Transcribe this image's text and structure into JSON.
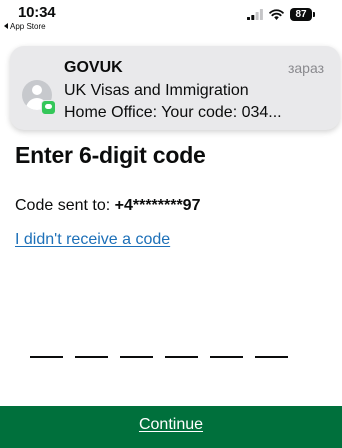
{
  "status_bar": {
    "time": "10:34",
    "back_label": "App Store",
    "battery_level": "87",
    "icons": [
      "signal-icon",
      "wifi-icon",
      "battery-icon"
    ]
  },
  "notification": {
    "sender": "GOVUK",
    "time": "зараз",
    "title": "UK Visas and Immigration",
    "body": "Home Office: Your code: 034...",
    "icons": [
      "contact-avatar-icon",
      "messages-badge-icon"
    ]
  },
  "page": {
    "title": "Enter 6-digit code",
    "code_sent_label": "Code sent to: ",
    "phone_number": "+4********97",
    "resend_link": "I didn't receive a code",
    "digits": [
      "",
      "",
      "",
      "",
      "",
      ""
    ]
  },
  "actions": {
    "continue_label": "Continue"
  },
  "colors": {
    "govuk_green": "#00703c",
    "link_blue": "#1d70b8",
    "text": "#0b0c0c",
    "notification_background": "#e9e9eb",
    "badge_green": "#34c759"
  }
}
